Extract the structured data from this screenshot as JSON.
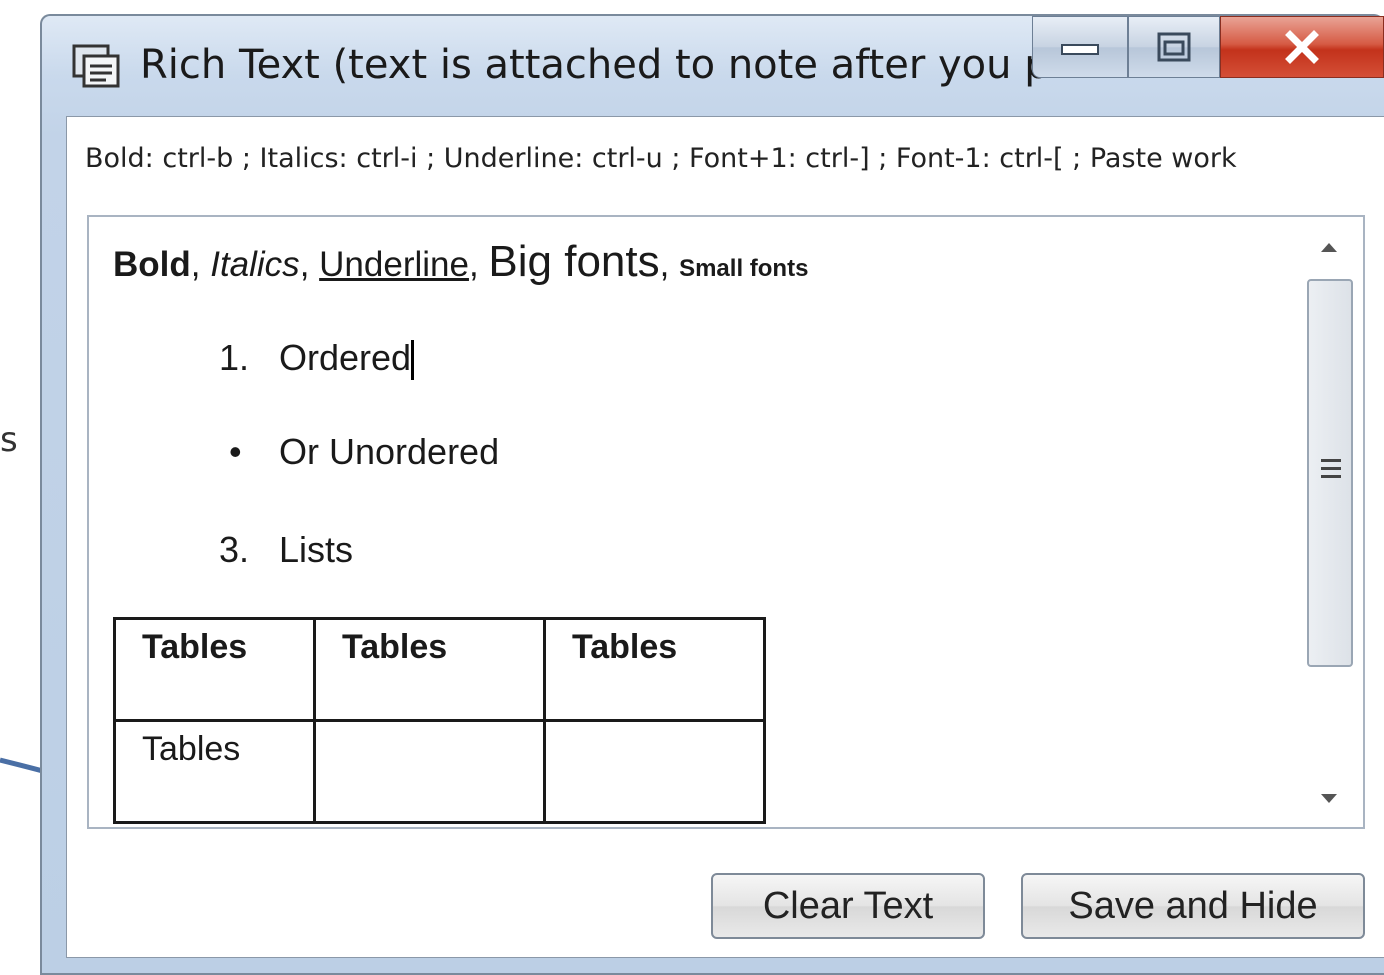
{
  "background": {
    "side_text": "s",
    "line_color": "#4a6fa5"
  },
  "window": {
    "title": "Rich Text (text is attached to note after you pr...",
    "icon": "rich-text-app-icon",
    "caption": {
      "minimize_icon": "minimize-icon",
      "maximize_icon": "maximize-icon",
      "close_icon": "close-icon",
      "close_color": "#c3321b"
    }
  },
  "hint": "Bold: ctrl-b ; Italics: ctrl-i ; Underline: ctrl-u ; Font+1: ctrl-] ; Font-1: ctrl-[ ; Paste work",
  "editor": {
    "line1": {
      "bold": "Bold",
      "sep1": ", ",
      "italics": "Italics",
      "sep2": ", ",
      "underline": "Underline",
      "sep3": ", ",
      "big": "Big fonts",
      "sep4": ", ",
      "small": "Small fonts"
    },
    "list": [
      {
        "marker": "1.",
        "text": "Ordered"
      },
      {
        "marker": "•",
        "text": "Or Unordered"
      },
      {
        "marker": "3.",
        "text": "Lists"
      }
    ],
    "table": {
      "rows": [
        [
          "Tables",
          "Tables",
          "Tables"
        ],
        [
          "Tables",
          "",
          ""
        ]
      ]
    }
  },
  "buttons": {
    "clear": "Clear Text",
    "save": "Save and Hide"
  }
}
